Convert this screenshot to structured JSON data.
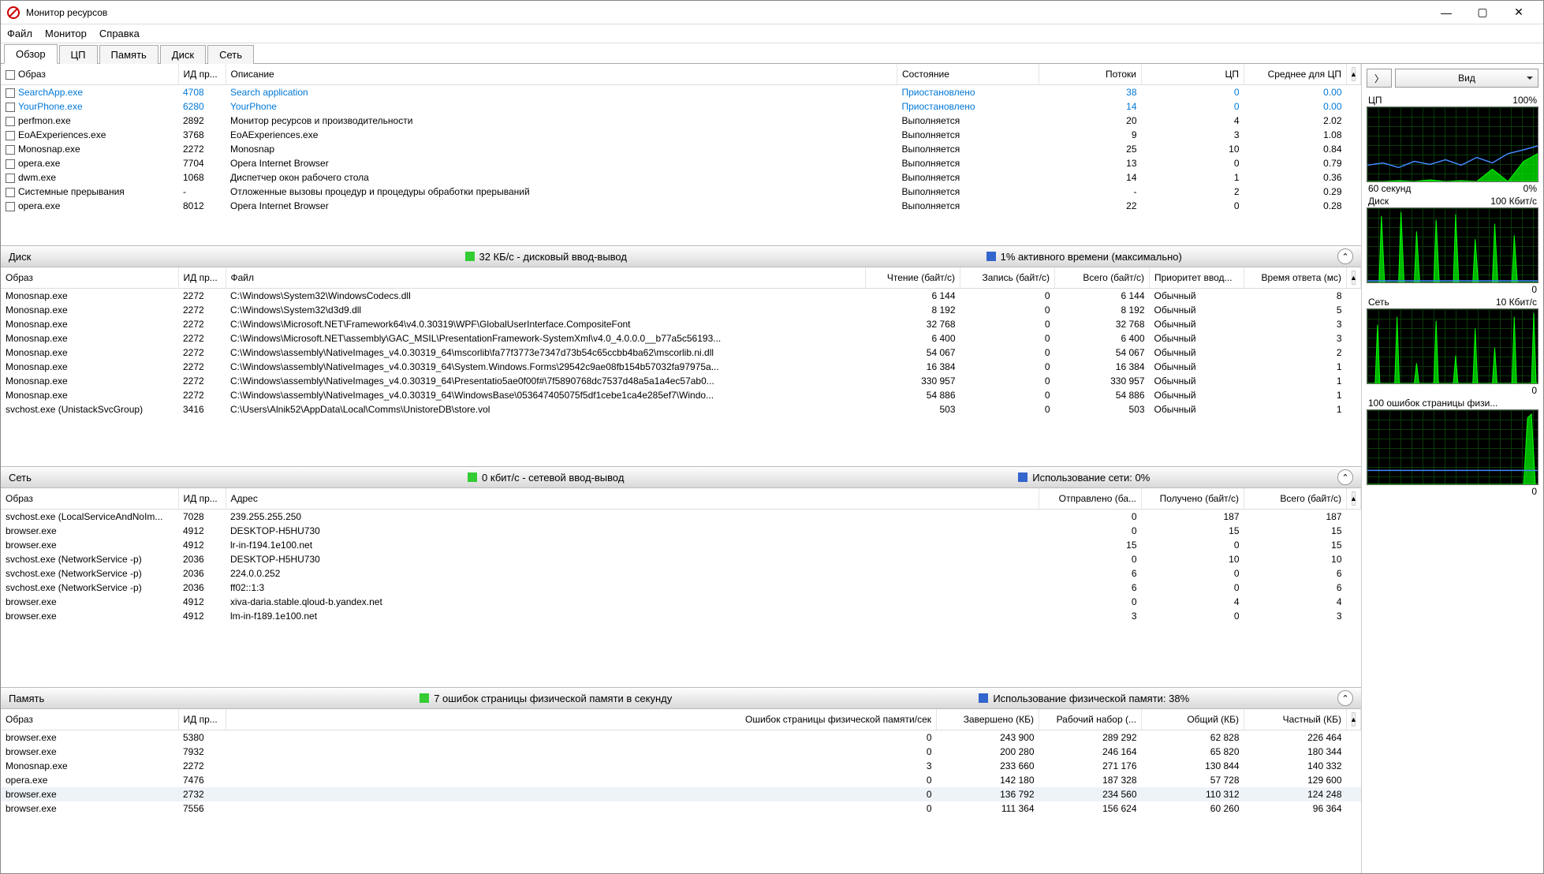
{
  "window": {
    "title": "Монитор ресурсов"
  },
  "menu": {
    "file": "Файл",
    "monitor": "Монитор",
    "help": "Справка"
  },
  "tabs": {
    "overview": "Обзор",
    "cpu": "ЦП",
    "memory": "Память",
    "disk": "Диск",
    "network": "Сеть"
  },
  "cpu_section": {
    "headers": {
      "image": "Образ",
      "pid": "ИД пр...",
      "desc": "Описание",
      "status": "Состояние",
      "threads": "Потоки",
      "cpu": "ЦП",
      "avgcpu": "Среднее для ЦП"
    },
    "rows": [
      {
        "image": "SearchApp.exe",
        "pid": "4708",
        "desc": "Search application",
        "status": "Приостановлено",
        "threads": "38",
        "cpu": "0",
        "avg": "0.00",
        "suspended": true
      },
      {
        "image": "YourPhone.exe",
        "pid": "6280",
        "desc": "YourPhone",
        "status": "Приостановлено",
        "threads": "14",
        "cpu": "0",
        "avg": "0.00",
        "suspended": true
      },
      {
        "image": "perfmon.exe",
        "pid": "2892",
        "desc": "Монитор ресурсов и производительности",
        "status": "Выполняется",
        "threads": "20",
        "cpu": "4",
        "avg": "2.02"
      },
      {
        "image": "EoAExperiences.exe",
        "pid": "3768",
        "desc": "EoAExperiences.exe",
        "status": "Выполняется",
        "threads": "9",
        "cpu": "3",
        "avg": "1.08"
      },
      {
        "image": "Monosnap.exe",
        "pid": "2272",
        "desc": "Monosnap",
        "status": "Выполняется",
        "threads": "25",
        "cpu": "10",
        "avg": "0.84"
      },
      {
        "image": "opera.exe",
        "pid": "7704",
        "desc": "Opera Internet Browser",
        "status": "Выполняется",
        "threads": "13",
        "cpu": "0",
        "avg": "0.79"
      },
      {
        "image": "dwm.exe",
        "pid": "1068",
        "desc": "Диспетчер окон рабочего стола",
        "status": "Выполняется",
        "threads": "14",
        "cpu": "1",
        "avg": "0.36"
      },
      {
        "image": "Системные прерывания",
        "pid": "-",
        "desc": "Отложенные вызовы процедур и процедуры обработки прерываний",
        "status": "Выполняется",
        "threads": "-",
        "cpu": "2",
        "avg": "0.29"
      },
      {
        "image": "opera.exe",
        "pid": "8012",
        "desc": "Opera Internet Browser",
        "status": "Выполняется",
        "threads": "22",
        "cpu": "0",
        "avg": "0.28"
      }
    ]
  },
  "disk_section": {
    "title": "Диск",
    "stat1": "32 КБ/с - дисковый ввод-вывод",
    "stat2": "1% активного времени (максимально)",
    "headers": {
      "image": "Образ",
      "pid": "ИД пр...",
      "file": "Файл",
      "read": "Чтение (байт/с)",
      "write": "Запись (байт/с)",
      "total": "Всего (байт/с)",
      "priority": "Приоритет ввод...",
      "resp": "Время ответа (мс)"
    },
    "rows": [
      {
        "image": "Monosnap.exe",
        "pid": "2272",
        "file": "C:\\Windows\\System32\\WindowsCodecs.dll",
        "read": "6 144",
        "write": "0",
        "total": "6 144",
        "priority": "Обычный",
        "resp": "8"
      },
      {
        "image": "Monosnap.exe",
        "pid": "2272",
        "file": "C:\\Windows\\System32\\d3d9.dll",
        "read": "8 192",
        "write": "0",
        "total": "8 192",
        "priority": "Обычный",
        "resp": "5"
      },
      {
        "image": "Monosnap.exe",
        "pid": "2272",
        "file": "C:\\Windows\\Microsoft.NET\\Framework64\\v4.0.30319\\WPF\\GlobalUserInterface.CompositeFont",
        "read": "32 768",
        "write": "0",
        "total": "32 768",
        "priority": "Обычный",
        "resp": "3"
      },
      {
        "image": "Monosnap.exe",
        "pid": "2272",
        "file": "C:\\Windows\\Microsoft.NET\\assembly\\GAC_MSIL\\PresentationFramework-SystemXml\\v4.0_4.0.0.0__b77a5c56193...",
        "read": "6 400",
        "write": "0",
        "total": "6 400",
        "priority": "Обычный",
        "resp": "3"
      },
      {
        "image": "Monosnap.exe",
        "pid": "2272",
        "file": "C:\\Windows\\assembly\\NativeImages_v4.0.30319_64\\mscorlib\\fa77f3773e7347d73b54c65ccbb4ba62\\mscorlib.ni.dll",
        "read": "54 067",
        "write": "0",
        "total": "54 067",
        "priority": "Обычный",
        "resp": "2"
      },
      {
        "image": "Monosnap.exe",
        "pid": "2272",
        "file": "C:\\Windows\\assembly\\NativeImages_v4.0.30319_64\\System.Windows.Forms\\29542c9ae08fb154b57032fa97975a...",
        "read": "16 384",
        "write": "0",
        "total": "16 384",
        "priority": "Обычный",
        "resp": "1"
      },
      {
        "image": "Monosnap.exe",
        "pid": "2272",
        "file": "C:\\Windows\\assembly\\NativeImages_v4.0.30319_64\\Presentatio5ae0f00f#\\7f5890768dc7537d48a5a1a4ec57ab0...",
        "read": "330 957",
        "write": "0",
        "total": "330 957",
        "priority": "Обычный",
        "resp": "1"
      },
      {
        "image": "Monosnap.exe",
        "pid": "2272",
        "file": "C:\\Windows\\assembly\\NativeImages_v4.0.30319_64\\WindowsBase\\053647405075f5df1cebe1ca4e285ef7\\Windo...",
        "read": "54 886",
        "write": "0",
        "total": "54 886",
        "priority": "Обычный",
        "resp": "1"
      },
      {
        "image": "svchost.exe (UnistackSvcGroup)",
        "pid": "3416",
        "file": "C:\\Users\\Alnik52\\AppData\\Local\\Comms\\UnistoreDB\\store.vol",
        "read": "503",
        "write": "0",
        "total": "503",
        "priority": "Обычный",
        "resp": "1"
      }
    ]
  },
  "net_section": {
    "title": "Сеть",
    "stat1": "0 кбит/с - сетевой ввод-вывод",
    "stat2": "Использование сети: 0%",
    "headers": {
      "image": "Образ",
      "pid": "ИД пр...",
      "addr": "Адрес",
      "sent": "Отправлено (ба...",
      "recv": "Получено (байт/с)",
      "total": "Всего (байт/с)"
    },
    "rows": [
      {
        "image": "svchost.exe (LocalServiceAndNoIm...",
        "pid": "7028",
        "addr": "239.255.255.250",
        "sent": "0",
        "recv": "187",
        "total": "187"
      },
      {
        "image": "browser.exe",
        "pid": "4912",
        "addr": "DESKTOP-H5HU730",
        "sent": "0",
        "recv": "15",
        "total": "15"
      },
      {
        "image": "browser.exe",
        "pid": "4912",
        "addr": "lr-in-f194.1e100.net",
        "sent": "15",
        "recv": "0",
        "total": "15"
      },
      {
        "image": "svchost.exe (NetworkService -p)",
        "pid": "2036",
        "addr": "DESKTOP-H5HU730",
        "sent": "0",
        "recv": "10",
        "total": "10"
      },
      {
        "image": "svchost.exe (NetworkService -p)",
        "pid": "2036",
        "addr": "224.0.0.252",
        "sent": "6",
        "recv": "0",
        "total": "6"
      },
      {
        "image": "svchost.exe (NetworkService -p)",
        "pid": "2036",
        "addr": "ff02::1:3",
        "sent": "6",
        "recv": "0",
        "total": "6"
      },
      {
        "image": "browser.exe",
        "pid": "4912",
        "addr": "xiva-daria.stable.qloud-b.yandex.net",
        "sent": "0",
        "recv": "4",
        "total": "4"
      },
      {
        "image": "browser.exe",
        "pid": "4912",
        "addr": "lm-in-f189.1e100.net",
        "sent": "3",
        "recv": "0",
        "total": "3"
      }
    ]
  },
  "mem_section": {
    "title": "Память",
    "stat1": "7 ошибок страницы физической памяти в секунду",
    "stat2": "Использование физической памяти: 38%",
    "headers": {
      "image": "Образ",
      "pid": "ИД пр...",
      "faults": "Ошибок страницы физической памяти/сек",
      "commit": "Завершено (КБ)",
      "ws": "Рабочий набор (...",
      "share": "Общий (КБ)",
      "private": "Частный (КБ)"
    },
    "rows": [
      {
        "image": "browser.exe",
        "pid": "5380",
        "faults": "0",
        "commit": "243 900",
        "ws": "289 292",
        "share": "62 828",
        "private": "226 464"
      },
      {
        "image": "browser.exe",
        "pid": "7932",
        "faults": "0",
        "commit": "200 280",
        "ws": "246 164",
        "share": "65 820",
        "private": "180 344"
      },
      {
        "image": "Monosnap.exe",
        "pid": "2272",
        "faults": "3",
        "commit": "233 660",
        "ws": "271 176",
        "share": "130 844",
        "private": "140 332"
      },
      {
        "image": "opera.exe",
        "pid": "7476",
        "faults": "0",
        "commit": "142 180",
        "ws": "187 328",
        "share": "57 728",
        "private": "129 600"
      },
      {
        "image": "browser.exe",
        "pid": "2732",
        "faults": "0",
        "commit": "136 792",
        "ws": "234 560",
        "share": "110 312",
        "private": "124 248",
        "hl": true
      },
      {
        "image": "browser.exe",
        "pid": "7556",
        "faults": "0",
        "commit": "111 364",
        "ws": "156 624",
        "share": "60 260",
        "private": "96 364"
      }
    ]
  },
  "sidebar": {
    "view_label": "Вид",
    "charts": [
      {
        "title_l": "ЦП",
        "title_r": "100%",
        "foot_l": "60 секунд",
        "foot_r": "0%"
      },
      {
        "title_l": "Диск",
        "title_r": "100 Кбит/с",
        "foot_l": "",
        "foot_r": "0"
      },
      {
        "title_l": "Сеть",
        "title_r": "10 Кбит/с",
        "foot_l": "",
        "foot_r": "0"
      },
      {
        "title_l": "100 ошибок страницы физи...",
        "title_r": "",
        "foot_l": "",
        "foot_r": "0"
      }
    ]
  }
}
